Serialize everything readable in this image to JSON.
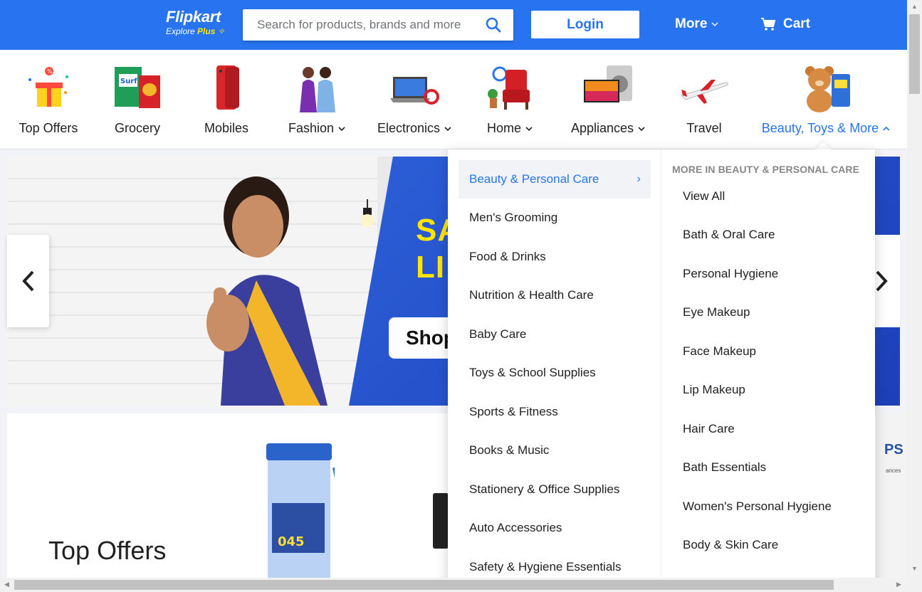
{
  "header": {
    "logo_main": "Flipkart",
    "logo_sub": "Explore",
    "logo_plus": "Plus",
    "search_placeholder": "Search for products, brands and more",
    "login_label": "Login",
    "more_label": "More",
    "cart_label": "Cart",
    "brand_color": "#2874f0"
  },
  "categories": [
    {
      "label": "Top Offers",
      "icon": "gift-icon"
    },
    {
      "label": "Grocery",
      "icon": "grocery-icon"
    },
    {
      "label": "Mobiles",
      "icon": "mobile-icon"
    },
    {
      "label": "Fashion",
      "icon": "fashion-icon",
      "dropdown": true
    },
    {
      "label": "Electronics",
      "icon": "laptop-icon",
      "dropdown": true
    },
    {
      "label": "Home",
      "icon": "armchair-icon",
      "dropdown": true
    },
    {
      "label": "Appliances",
      "icon": "tv-icon",
      "dropdown": true
    },
    {
      "label": "Travel",
      "icon": "airplane-icon"
    },
    {
      "label": "Beauty, Toys & More",
      "icon": "teddy-bear-icon",
      "dropdown": true,
      "active": true
    }
  ],
  "banner": {
    "headline_top": "SA",
    "headline_bottom": "LI",
    "button_label": "Shop"
  },
  "offers": {
    "title": "Top Offers",
    "promo_text": "PS",
    "promo_sub": "ances"
  },
  "dropdown": {
    "left_items": [
      "Beauty & Personal Care",
      "Men's Grooming",
      "Food & Drinks",
      "Nutrition & Health Care",
      "Baby Care",
      "Toys & School Supplies",
      "Sports & Fitness",
      "Books & Music",
      "Stationery & Office Supplies",
      "Auto Accessories",
      "Safety & Hygiene Essentials"
    ],
    "right_heading": "MORE IN BEAUTY & PERSONAL CARE",
    "right_items": [
      "View All",
      "Bath & Oral Care",
      "Personal Hygiene",
      "Eye Makeup",
      "Face Makeup",
      "Lip Makeup",
      "Hair Care",
      "Bath Essentials",
      "Women's Personal Hygiene",
      "Body & Skin Care"
    ]
  }
}
